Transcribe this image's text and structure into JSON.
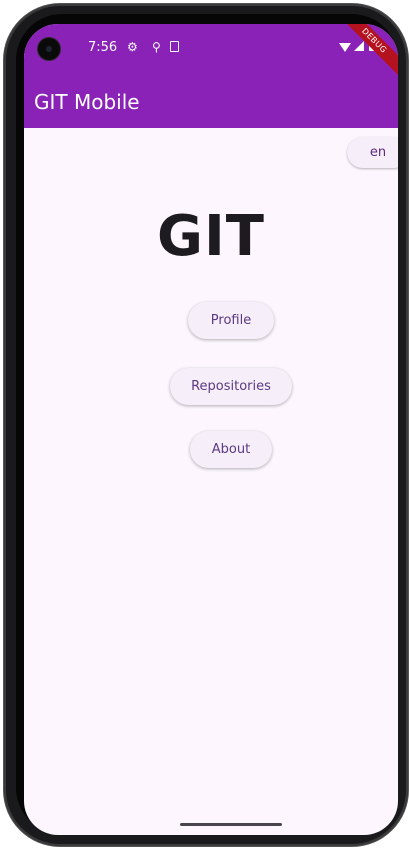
{
  "status_bar": {
    "time": "7:56",
    "icons": [
      "settings-gear-icon",
      "usb-icon",
      "screenshot-icon",
      "wifi-icon",
      "signal-icon",
      "battery-icon"
    ]
  },
  "debug_banner": "DEBUG",
  "app_bar": {
    "title": "GIT Mobile",
    "color": "#8a22b8"
  },
  "language_button": {
    "label": "en"
  },
  "main": {
    "headline": "GIT",
    "buttons": [
      {
        "label": "Profile"
      },
      {
        "label": "Repositories"
      },
      {
        "label": "About"
      }
    ]
  },
  "colors": {
    "background": "#fdf6fe",
    "button_text": "#5b3a82"
  }
}
